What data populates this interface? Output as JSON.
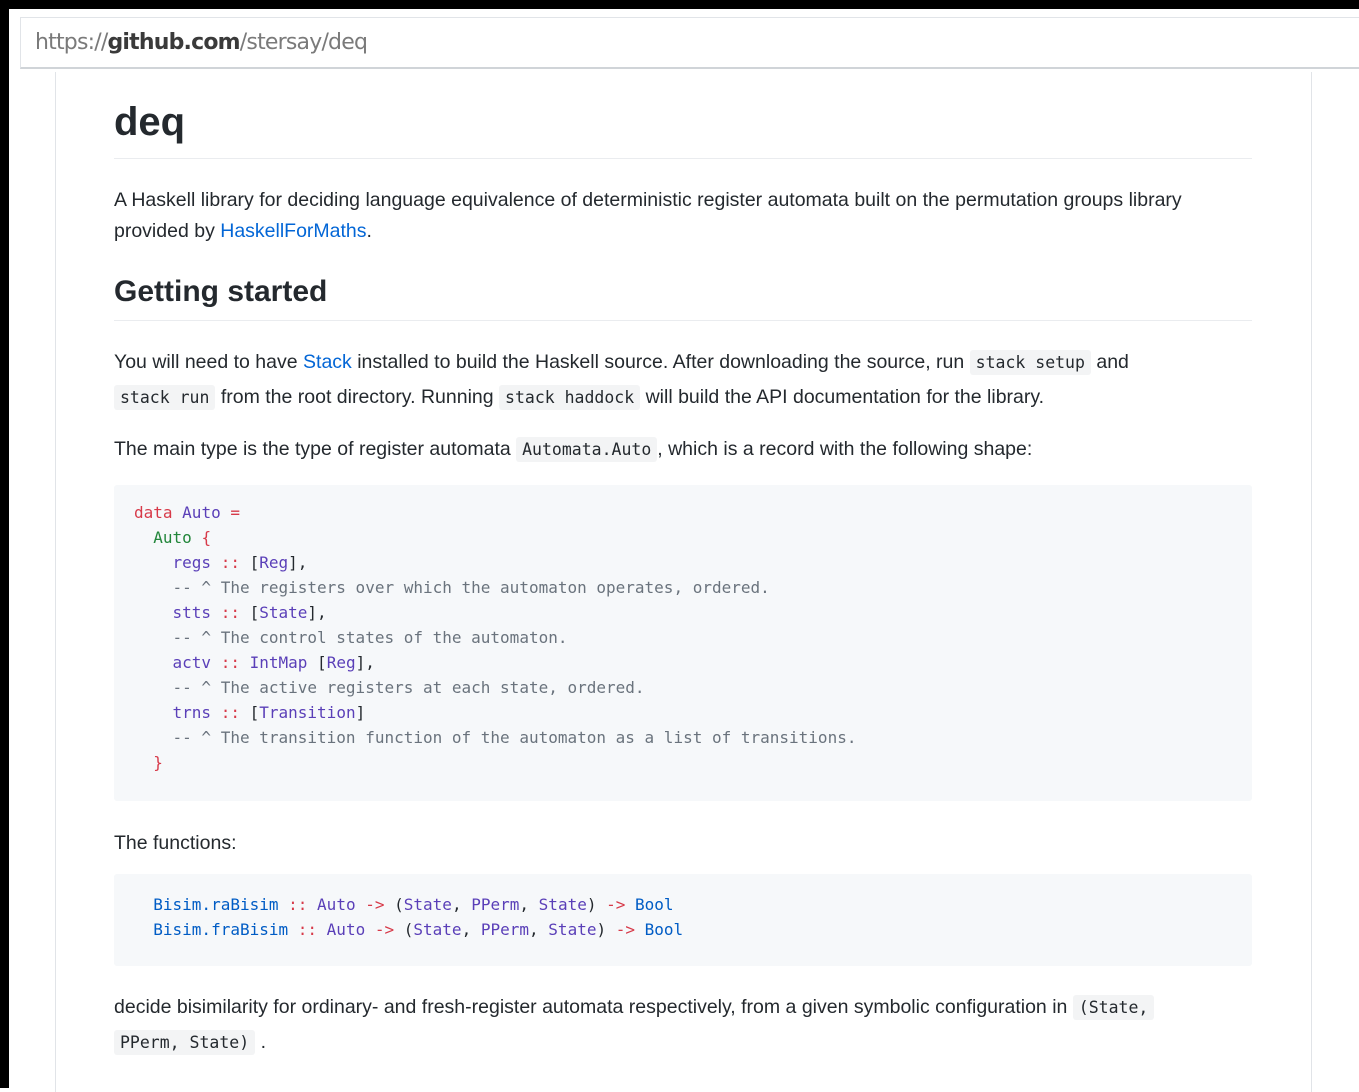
{
  "url": {
    "scheme": "https://",
    "host": "github.com",
    "path": "/stersay/deq"
  },
  "readme": {
    "title": "deq",
    "intro_pre": "A Haskell library for deciding language equivalence of deterministic register automata built on the permutation groups library provided by ",
    "intro_link": "HaskellForMaths",
    "intro_post": ".",
    "section_title": "Getting started",
    "p1": {
      "t1": "You will need to have ",
      "link": "Stack",
      "t2": " installed to build the Haskell source. After downloading the source, run ",
      "c1": "stack setup",
      "t3": " and ",
      "c2": "stack run",
      "t4": " from the root directory. Running ",
      "c3": "stack haddock",
      "t5": " will build the API documentation for the library."
    },
    "p2": {
      "t1": "The main type is the type of register automata ",
      "c1": "Automata.Auto",
      "t2": ", which is a record with the following shape:"
    },
    "code1": {
      "l1": {
        "kw": "data",
        "ty": "Auto",
        "eq": "="
      },
      "l2": {
        "con": "Auto",
        "brace": "{"
      },
      "l3": {
        "field": "regs",
        "sep": "::",
        "lb": "[",
        "ty": "Reg",
        "rb": "],"
      },
      "l4": "-- ^ The registers over which the automaton operates, ordered.",
      "l5": {
        "field": "stts",
        "sep": "::",
        "lb": "[",
        "ty": "State",
        "rb": "],"
      },
      "l6": "-- ^ The control states of the automaton.",
      "l7": {
        "field": "actv",
        "sep": "::",
        "ty1": "IntMap",
        "lb": "[",
        "ty": "Reg",
        "rb": "],"
      },
      "l8": "-- ^ The active registers at each state, ordered.",
      "l9": {
        "field": "trns",
        "sep": "::",
        "lb": "[",
        "ty": "Transition",
        "rb": "]"
      },
      "l10": "-- ^ The transition function of the automaton as a list of transitions.",
      "l11": "}"
    },
    "p3": "The functions:",
    "code2": {
      "l1": {
        "fn": "Bisim.raBisim",
        "sep": "::",
        "a": "Auto",
        "arrow": "->",
        "lp": "(",
        "s1": "State",
        "c1": ",",
        "pp": "PPerm",
        "c2": ",",
        "s2": "State",
        "rp": ")",
        "arrow2": "->",
        "r": "Bool"
      },
      "l2": {
        "fn": "Bisim.fraBisim",
        "sep": "::",
        "a": "Auto",
        "arrow": "->",
        "lp": "(",
        "s1": "State",
        "c1": ",",
        "pp": "PPerm",
        "c2": ",",
        "s2": "State",
        "rp": ")",
        "arrow2": "->",
        "r": "Bool"
      }
    },
    "p4": {
      "t1": "decide bisimilarity for ordinary- and fresh-register automata respectively, from a given symbolic configuration in ",
      "c1a": "(State,",
      "c1b": "PPerm, State)",
      "t2": "."
    }
  }
}
